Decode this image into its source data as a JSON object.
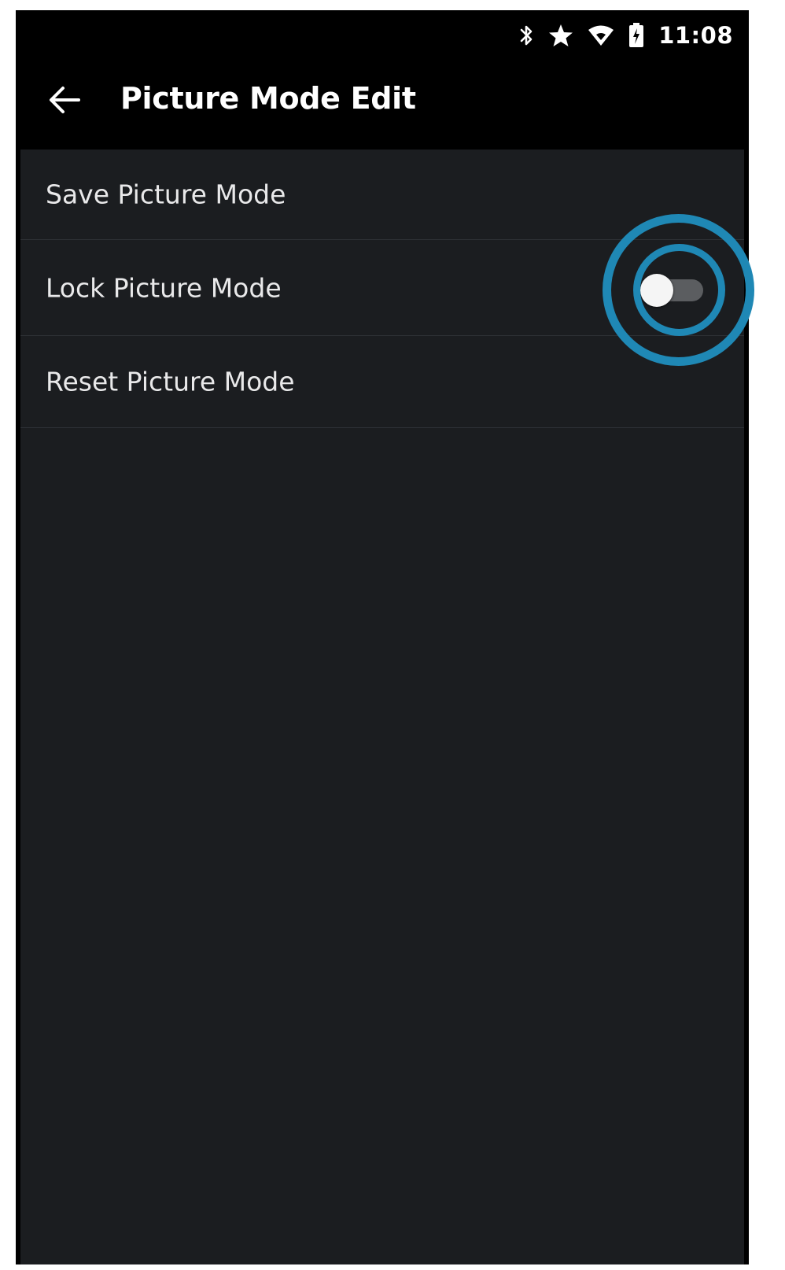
{
  "status_bar": {
    "icons": [
      "bluetooth-icon",
      "star-icon",
      "wifi-icon",
      "battery-charging-icon"
    ],
    "time": "11:08"
  },
  "app_bar": {
    "back_icon": "arrow-left-icon",
    "title": "Picture Mode Edit"
  },
  "menu": {
    "items": [
      {
        "label": "Save Picture Mode"
      },
      {
        "label": "Lock Picture Mode",
        "toggle": {
          "state": "off"
        }
      },
      {
        "label": "Reset Picture Mode"
      }
    ]
  },
  "colors": {
    "background": "#000000",
    "panel": "#1b1d20",
    "divider": "#2d3035",
    "highlight": "#1f88b5",
    "toggle_track": "#5b5d60",
    "toggle_thumb": "#f5f5f5"
  }
}
